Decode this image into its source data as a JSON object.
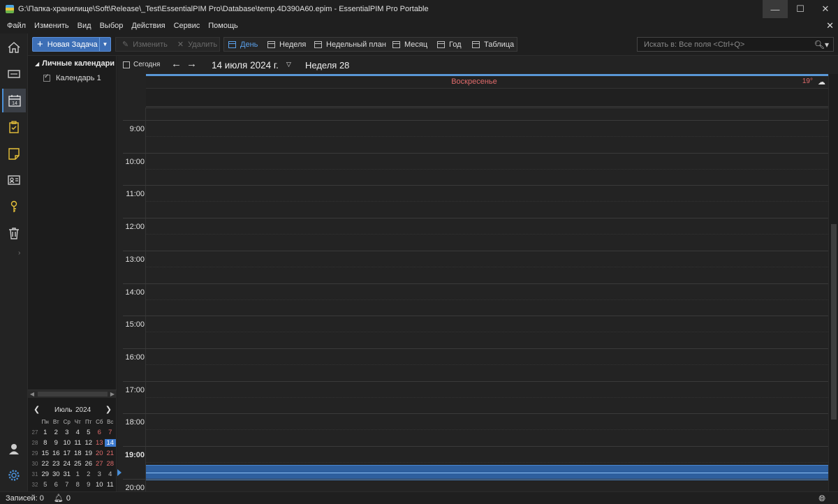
{
  "window": {
    "title": "G:\\Папка-хранилище\\Soft\\Release\\_Test\\EssentialPIM Pro\\Database\\temp.4D390A60.epim - EssentialPIM Pro Portable",
    "min": "—",
    "max": "☐",
    "close": "✕"
  },
  "menu": [
    "Файл",
    "Изменить",
    "Вид",
    "Выбор",
    "Действия",
    "Сервис",
    "Помощь"
  ],
  "menu_close": "✕",
  "toolbar": {
    "new_task": "Новая Задача",
    "edit": "Изменить",
    "delete": "Удалить",
    "views": [
      "День",
      "Неделя",
      "Недельный план",
      "Месяц",
      "Год",
      "Таблица"
    ],
    "active_view": "День",
    "search_placeholder": "Искать в: Все поля  <Ctrl+Q>"
  },
  "left_panel": {
    "group_title": "Личные календари",
    "calendar_item": "Календарь 1"
  },
  "mini_calendar": {
    "month": "Июль",
    "year": "2024",
    "weekdays": [
      "Пн",
      "Вт",
      "Ср",
      "Чт",
      "Пт",
      "Сб",
      "Вс"
    ],
    "weeks": [
      {
        "wk": "27",
        "days": [
          "1",
          "2",
          "3",
          "4",
          "5",
          "6",
          "7"
        ]
      },
      {
        "wk": "28",
        "days": [
          "8",
          "9",
          "10",
          "11",
          "12",
          "13",
          "14"
        ]
      },
      {
        "wk": "29",
        "days": [
          "15",
          "16",
          "17",
          "18",
          "19",
          "20",
          "21"
        ]
      },
      {
        "wk": "30",
        "days": [
          "22",
          "23",
          "24",
          "25",
          "26",
          "27",
          "28"
        ]
      },
      {
        "wk": "31",
        "days": [
          "29",
          "30",
          "31",
          "1",
          "2",
          "3",
          "4"
        ]
      },
      {
        "wk": "32",
        "days": [
          "5",
          "6",
          "7",
          "8",
          "9",
          "10",
          "11"
        ]
      }
    ],
    "selected_day": "14"
  },
  "navigation": {
    "today": "Сегодня",
    "back": "←",
    "forward": "→",
    "date": "14 июля 2024 г.",
    "dropdown": "⌄",
    "week": "Неделя 28"
  },
  "day_header": {
    "day_name": "Воскресенье",
    "temperature": "19°",
    "weather_icon": "cloud-icon"
  },
  "hours": [
    "9:00",
    "10:00",
    "11:00",
    "12:00",
    "13:00",
    "14:00",
    "15:00",
    "16:00",
    "17:00",
    "18:00",
    "19:00",
    "20:00"
  ],
  "current_hour": "19:00",
  "status": {
    "records": "Записей: 0",
    "reminders": "0"
  },
  "colors": {
    "accent": "#3d7bd1",
    "weekend": "#e06b6b",
    "background": "#1e1e1e"
  }
}
